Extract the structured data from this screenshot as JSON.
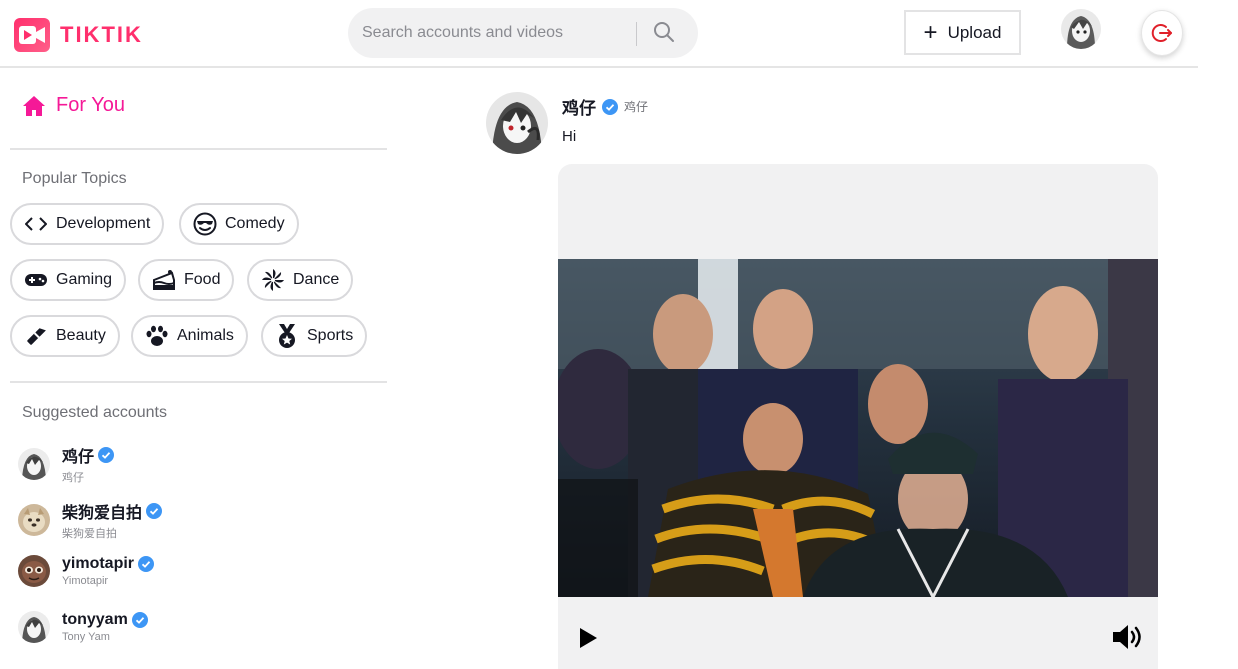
{
  "app": {
    "name": "TIKTIK",
    "brand_color": "#ff2f6d",
    "accent_color": "#f51997"
  },
  "header": {
    "search": {
      "placeholder": "Search accounts and videos",
      "value": ""
    },
    "upload_label": "Upload",
    "icons": {
      "search": "search-icon",
      "upload": "plus-icon",
      "logout": "logout-icon"
    }
  },
  "sidebar": {
    "for_you_label": "For You",
    "popular_topics_title": "Popular Topics",
    "topics": [
      {
        "label": "Development",
        "icon": "code-icon"
      },
      {
        "label": "Comedy",
        "icon": "sunglasses-face-icon"
      },
      {
        "label": "Gaming",
        "icon": "gamepad-icon"
      },
      {
        "label": "Food",
        "icon": "cake-icon"
      },
      {
        "label": "Dance",
        "icon": "pinwheel-icon"
      },
      {
        "label": "Beauty",
        "icon": "lipstick-icon"
      },
      {
        "label": "Animals",
        "icon": "paw-icon"
      },
      {
        "label": "Sports",
        "icon": "medal-icon"
      }
    ],
    "suggested_title": "Suggested accounts",
    "accounts": [
      {
        "name": "鸡仔",
        "handle": "鸡仔",
        "verified": true
      },
      {
        "name": "柴狗爱自拍",
        "handle": "柴狗爱自拍",
        "verified": true
      },
      {
        "name": "yimotapir",
        "handle": "Yimotapir",
        "verified": true
      },
      {
        "name": "tonyyam",
        "handle": "Tony Yam",
        "verified": true
      }
    ]
  },
  "feed": {
    "post": {
      "author_name": "鸡仔",
      "author_handle": "鸡仔",
      "verified": true,
      "caption": "Hi",
      "controls": {
        "play": "play-icon",
        "volume": "volume-icon"
      }
    }
  }
}
